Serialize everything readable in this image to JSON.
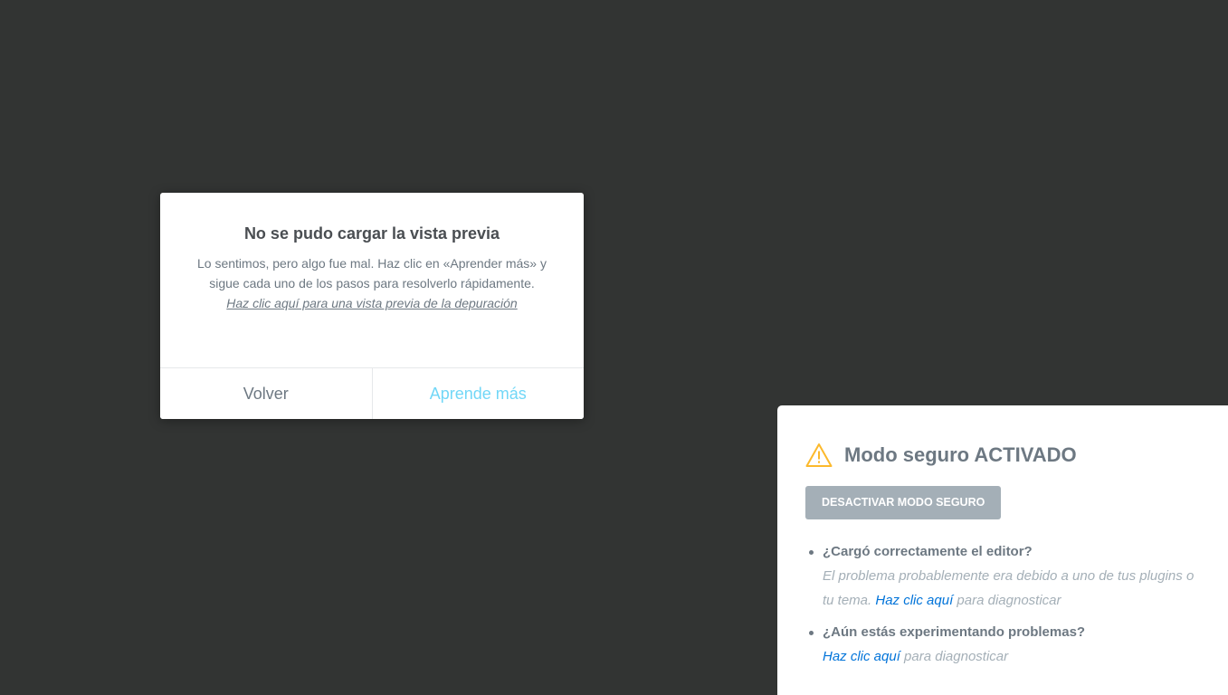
{
  "dialog": {
    "title": "No se pudo cargar la vista previa",
    "message": "Lo sentimos, pero algo fue mal. Haz clic en «Aprender más» y sigue cada uno de los pasos para resolverlo rápidamente.",
    "debug_link": "Haz clic aquí para una vista previa de la depuración",
    "back_label": "Volver",
    "learn_label": "Aprende más"
  },
  "safe_mode": {
    "icon": "warning-icon",
    "title": "Modo seguro ACTIVADO",
    "button_label": "DESACTIVAR MODO SEGURO",
    "tips": [
      {
        "question": "¿Cargó correctamente el editor?",
        "text": "El problema probablemente era debido a uno de tus plugins o tu tema.",
        "link": "Haz clic aquí",
        "suffix": "para diagnosticar"
      },
      {
        "question": "¿Aún estás experimentando problemas?",
        "link": "Haz clic aquí",
        "suffix": "para diagnosticar"
      }
    ]
  },
  "colors": {
    "background": "#323433",
    "accent_link": "#0073d9",
    "learn_more": "#71d7f7",
    "warning": "#fcb92c",
    "button_gray": "#a4afb7"
  }
}
